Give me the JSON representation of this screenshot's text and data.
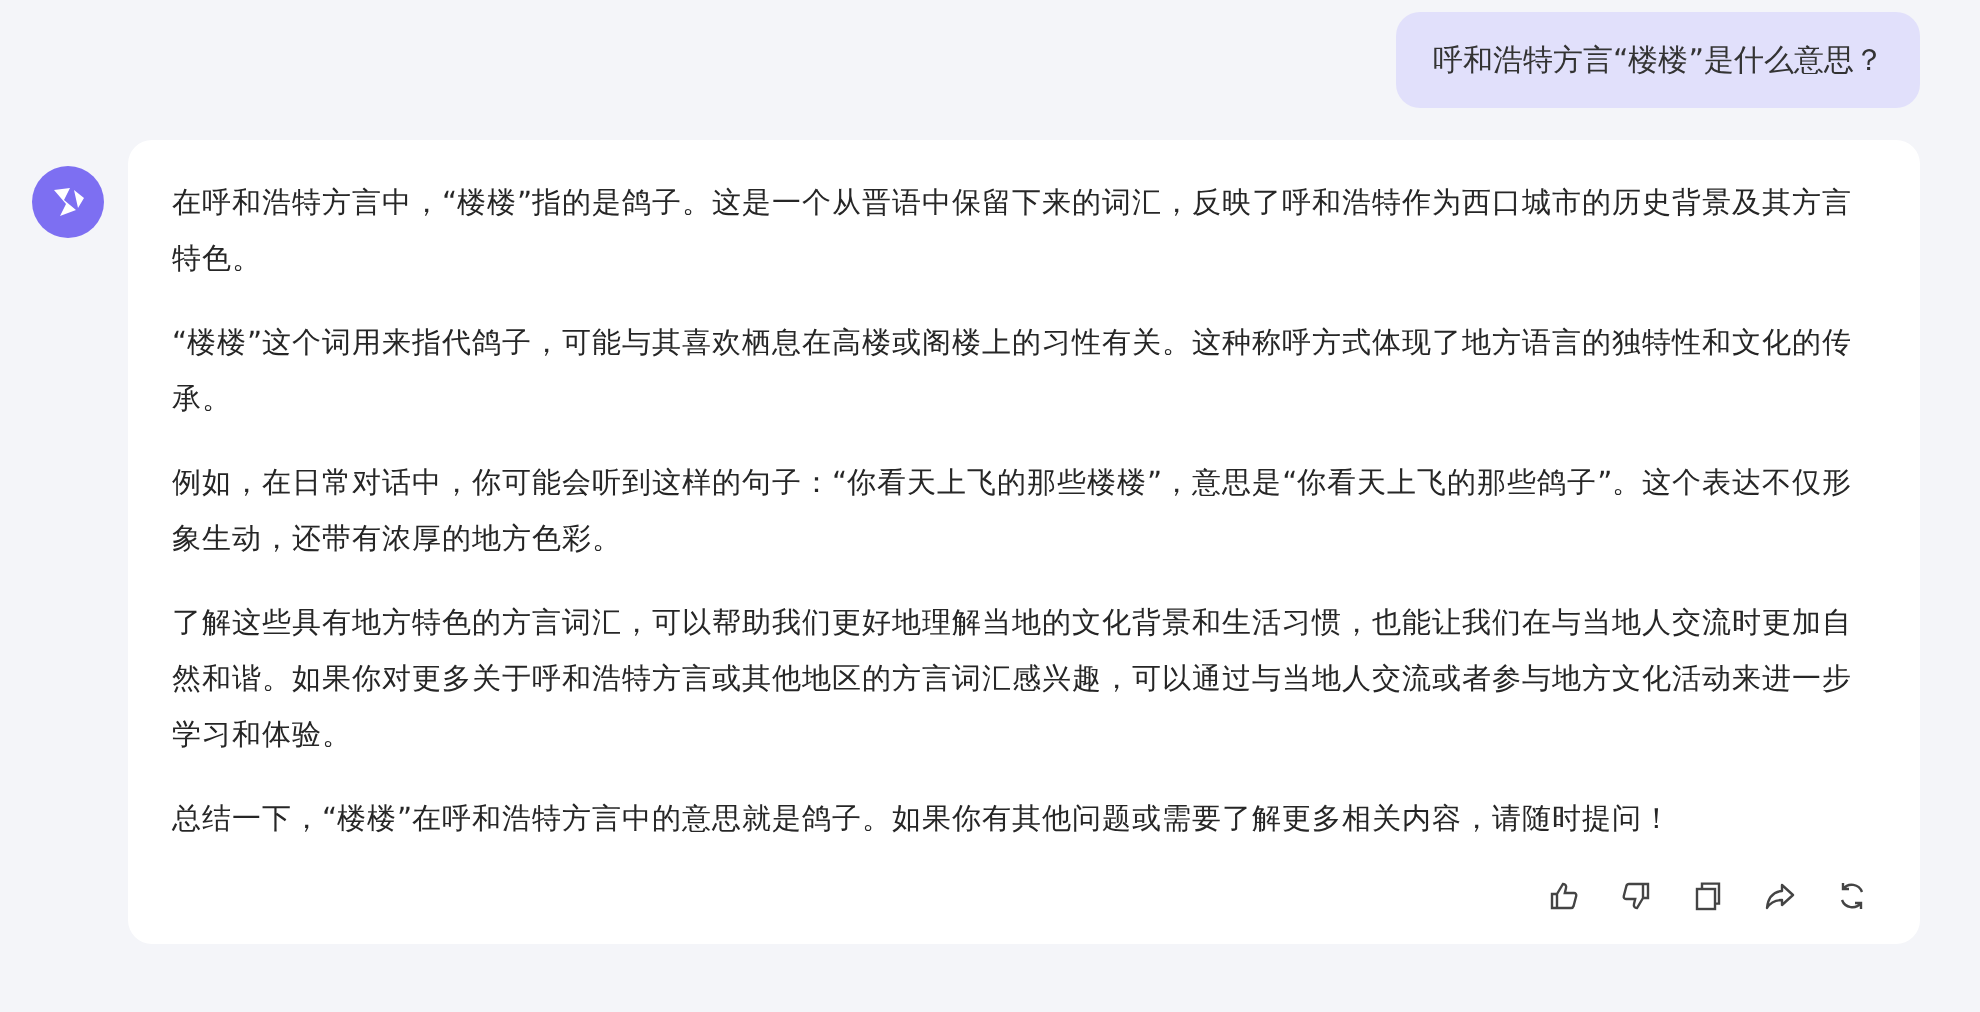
{
  "user_message": {
    "text": "呼和浩特方言“楼楼”是什么意思？"
  },
  "reply": {
    "paragraphs": [
      "在呼和浩特方言中，“楼楼”指的是鸽子。这是一个从晋语中保留下来的词汇，反映了呼和浩特作为西口城市的历史背景及其方言特色。",
      "“楼楼”这个词用来指代鸽子，可能与其喜欢栖息在高楼或阁楼上的习性有关。这种称呼方式体现了地方语言的独特性和文化的传承。",
      "例如，在日常对话中，你可能会听到这样的句子：“你看天上飞的那些楼楼”，意思是“你看天上飞的那些鸽子”。这个表达不仅形象生动，还带有浓厚的地方色彩。",
      "了解这些具有地方特色的方言词汇，可以帮助我们更好地理解当地的文化背景和生活习惯，也能让我们在与当地人交流时更加自然和谐。如果你对更多关于呼和浩特方言或其他地区的方言词汇感兴趣，可以通过与当地人交流或者参与地方文化活动来进一步学习和体验。",
      "总结一下，“楼楼”在呼和浩特方言中的意思就是鸽子。如果你有其他问题或需要了解更多相关内容，请随时提问！"
    ],
    "actions": [
      {
        "kind": "like"
      },
      {
        "kind": "dislike"
      },
      {
        "kind": "copy"
      },
      {
        "kind": "share"
      },
      {
        "kind": "regenerate"
      }
    ]
  }
}
